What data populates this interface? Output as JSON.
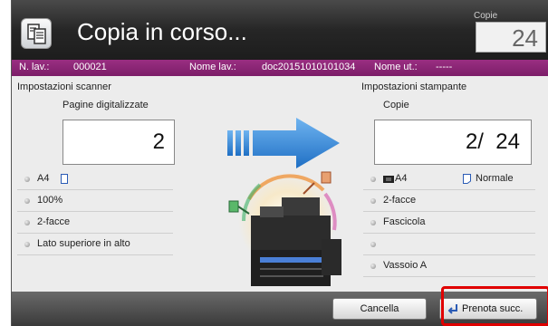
{
  "header": {
    "title": "Copia in corso...",
    "copies_label": "Copie",
    "copies_value": "24"
  },
  "job_bar": {
    "job_no_label": "N. lav.:",
    "job_no_value": "000021",
    "job_name_label": "Nome lav.:",
    "job_name_value": "doc20151010101034",
    "user_label": "Nome ut.:",
    "user_value": "-----"
  },
  "scanner": {
    "section_title": "Impostazioni scanner",
    "pages_title": "Pagine digitalizzate",
    "pages_value": "2",
    "rows": [
      "A4",
      "100%",
      "2-facce",
      "Lato superiore in alto"
    ]
  },
  "printer": {
    "section_title": "Impostazioni stampante",
    "copies_title": "Copie",
    "copies_value": "2/  24",
    "rows": [
      "A4",
      "2-facce",
      "Fascicola",
      "",
      "Vassoio A"
    ],
    "paper_type": "Normale"
  },
  "footer": {
    "cancel_label": "Cancella",
    "reserve_next_label": "Prenota succ."
  },
  "colors": {
    "job_bar": "#8b2477",
    "highlight": "#e00000",
    "arrow": "#2f86d8"
  },
  "icons": [
    "document-copy-icon",
    "portrait-page-icon",
    "paper-tray-icon",
    "paper-icon",
    "flow-arrow-icon",
    "printer-illustration",
    "reserve-icon"
  ]
}
